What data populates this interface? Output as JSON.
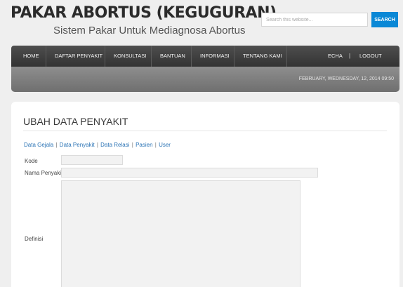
{
  "site": {
    "title": "PAKAR ABORTUS (KEGUGURAN)",
    "subtitle": "Sistem Pakar Untuk Mediagnosa Abortus"
  },
  "search": {
    "placeholder": "Search this website...",
    "button_label": "SEARCH"
  },
  "nav": {
    "items": [
      {
        "label": "HOME"
      },
      {
        "label": "DAFTAR PENYAKIT"
      },
      {
        "label": "KONSULTASI"
      },
      {
        "label": "BANTUAN"
      },
      {
        "label": "INFORMASI"
      },
      {
        "label": "TENTANG KAMI"
      }
    ],
    "user": "ECHA",
    "logout": "LOGOUT",
    "pipe": "|"
  },
  "date_bar": {
    "text": "FEBRUARY, WEDNESDAY, 12, 2014 09:50"
  },
  "panel": {
    "title": "UBAH DATA PENYAKIT",
    "links": [
      "Data Gejala",
      "Data Penyakit",
      "Data Relasi",
      "Pasien",
      "User"
    ],
    "separator": "|"
  },
  "form": {
    "kode_label": "Kode",
    "nama_label": "Nama Penyakit",
    "definisi_label": "Definisi",
    "kode_value": "",
    "nama_value": "",
    "definisi_value": ""
  },
  "colors": {
    "accent": "#0a88d6",
    "link": "#2a73b5",
    "nav_bg": "#3f3f3f"
  }
}
